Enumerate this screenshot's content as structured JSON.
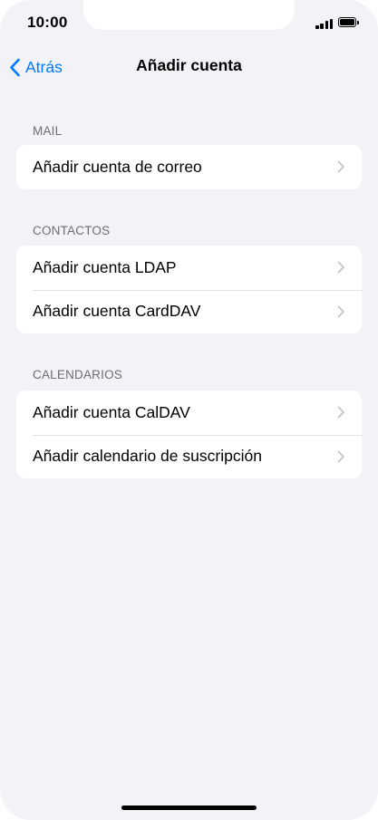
{
  "status_bar": {
    "time": "10:00"
  },
  "nav": {
    "back_label": "Atrás",
    "title": "Añadir cuenta"
  },
  "accent_color": "#007aff",
  "sections": {
    "mail": {
      "header": "MAIL",
      "items": [
        {
          "label": "Añadir cuenta de correo"
        }
      ]
    },
    "contactos": {
      "header": "CONTACTOS",
      "items": [
        {
          "label": "Añadir cuenta LDAP"
        },
        {
          "label": "Añadir cuenta CardDAV"
        }
      ]
    },
    "calendarios": {
      "header": "CALENDARIOS",
      "items": [
        {
          "label": "Añadir cuenta CalDAV"
        },
        {
          "label": "Añadir calendario de suscripción"
        }
      ]
    }
  },
  "icons": [
    "chevron-left-icon",
    "chevron-right-icon",
    "signal-icon",
    "battery-icon"
  ]
}
